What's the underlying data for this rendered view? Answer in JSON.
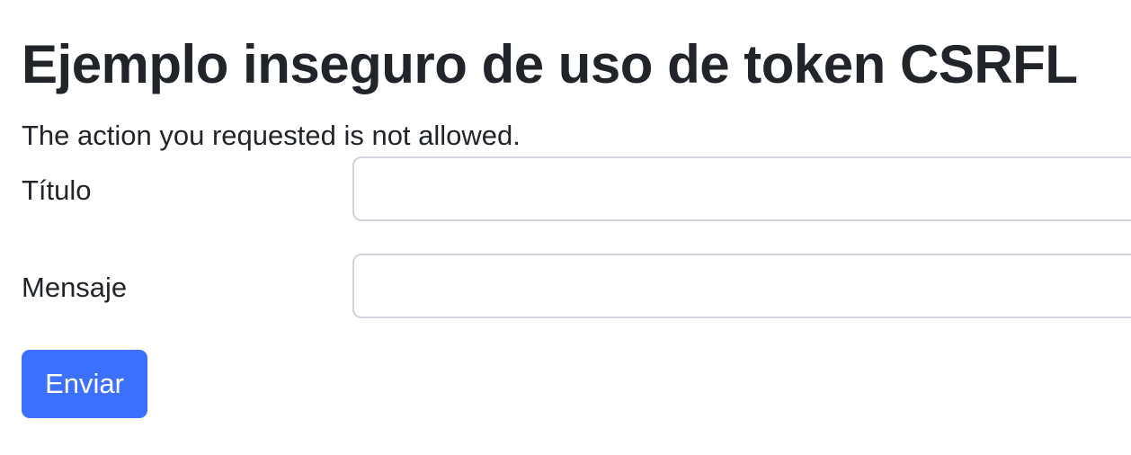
{
  "page": {
    "title": "Ejemplo inseguro de uso de token CSRFL",
    "error_message": "The action you requested is not allowed."
  },
  "form": {
    "titulo": {
      "label": "Título",
      "value": "",
      "placeholder": ""
    },
    "mensaje": {
      "label": "Mensaje",
      "value": "",
      "placeholder": ""
    },
    "submit_label": "Enviar"
  },
  "colors": {
    "text": "#212529",
    "input_border": "#ced4da",
    "primary_button": "#3b71fe",
    "button_text": "#ffffff",
    "background": "#ffffff"
  }
}
